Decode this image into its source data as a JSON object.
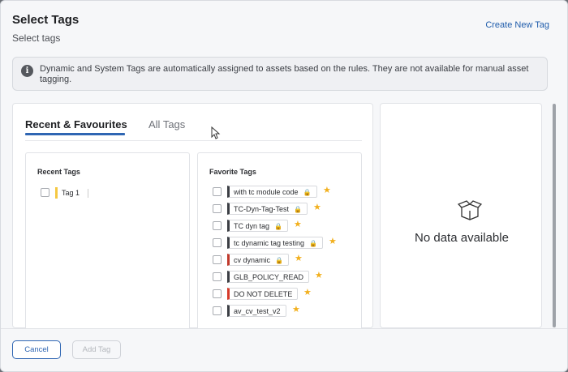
{
  "header": {
    "title": "Select Tags",
    "subtitle": "Select tags",
    "create_link": "Create New Tag"
  },
  "info": {
    "text": "Dynamic and System Tags are automatically assigned to assets based on the rules. They are not available for manual asset tagging."
  },
  "tabs": [
    {
      "label": "Recent & Favourites",
      "active": true
    },
    {
      "label": "All Tags",
      "active": false
    }
  ],
  "recent": {
    "title": "Recent Tags",
    "items": [
      {
        "label": "Tag 1",
        "color": "#f5c842"
      }
    ]
  },
  "favorites": {
    "title": "Favorite Tags",
    "items": [
      {
        "label": "with tc module code",
        "locked": true,
        "color": "#3b3e44"
      },
      {
        "label": "TC-Dyn-Tag-Test",
        "locked": true,
        "color": "#3b3e44"
      },
      {
        "label": "TC dyn tag",
        "locked": true,
        "color": "#3b3e44"
      },
      {
        "label": "tc dynamic tag testing",
        "locked": true,
        "color": "#3b3e44"
      },
      {
        "label": "cv dynamic",
        "locked": true,
        "color": "#c0392b"
      },
      {
        "label": "GLB_POLICY_READ",
        "locked": false,
        "color": "#3b3e44"
      },
      {
        "label": "DO NOT DELETE",
        "locked": false,
        "color": "#d63a2a"
      },
      {
        "label": "av_cv_test_v2",
        "locked": false,
        "color": "#3b3e44"
      }
    ]
  },
  "empty_state": {
    "text": "No data available",
    "icon": "empty-box-icon"
  },
  "footer": {
    "cancel_label": "Cancel",
    "add_label": "Add Tag"
  },
  "colors": {
    "accent": "#2f66b3",
    "star": "#f2b01e"
  }
}
